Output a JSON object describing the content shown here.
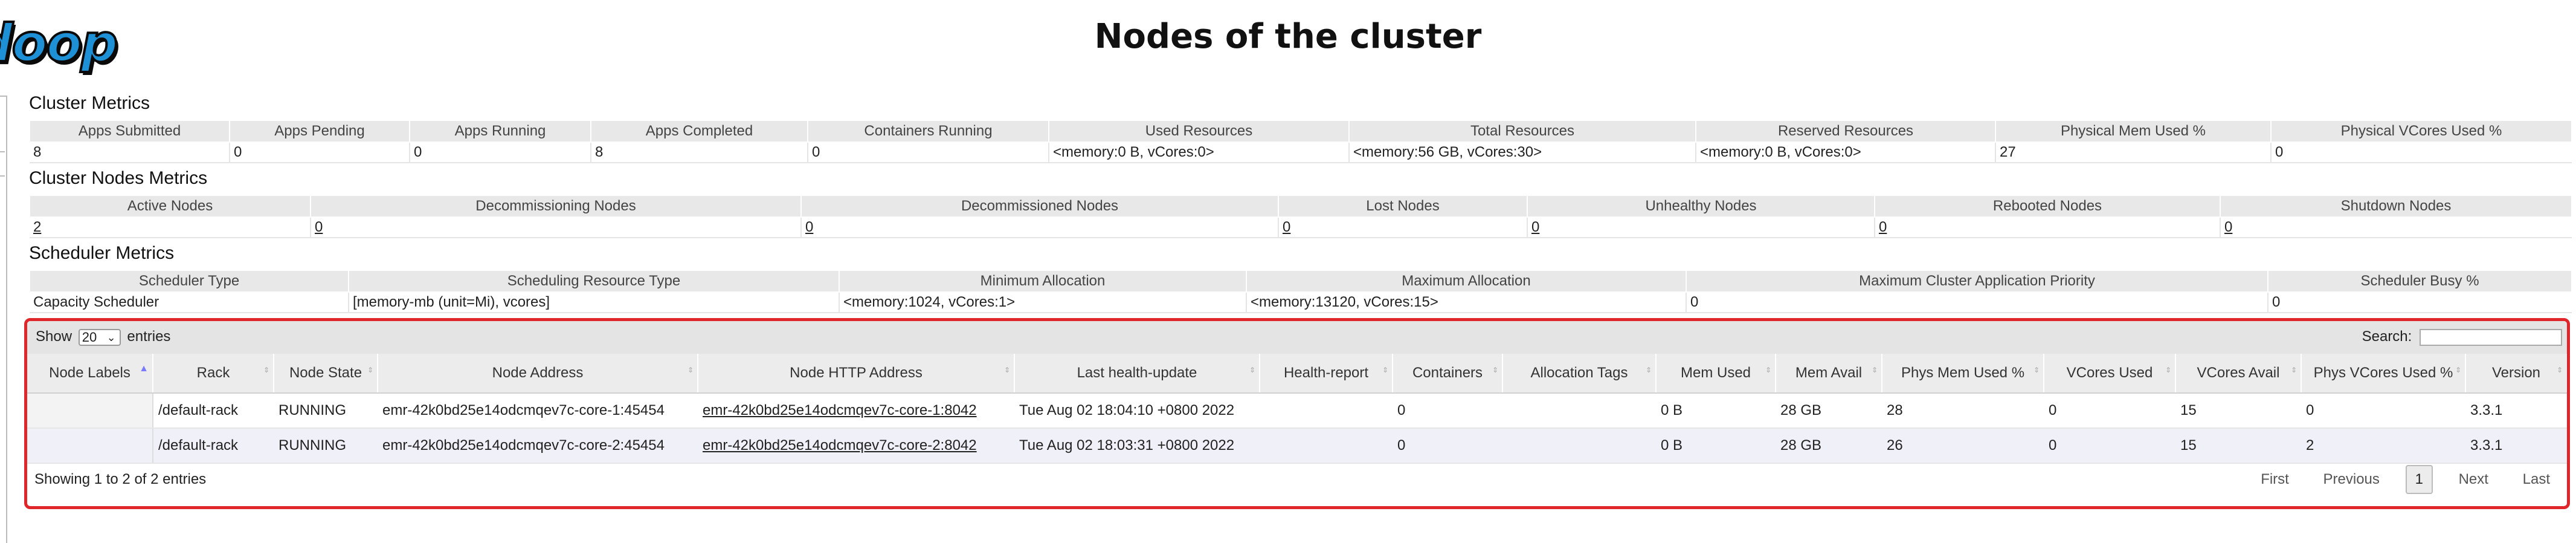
{
  "page": {
    "title": "Nodes of the cluster",
    "logo_text": "doop"
  },
  "cluster_metrics": {
    "title": "Cluster Metrics",
    "headers": [
      "Apps Submitted",
      "Apps Pending",
      "Apps Running",
      "Apps Completed",
      "Containers Running",
      "Used Resources",
      "Total Resources",
      "Reserved Resources",
      "Physical Mem Used %",
      "Physical VCores Used %"
    ],
    "values": [
      "8",
      "0",
      "0",
      "8",
      "0",
      "<memory:0 B, vCores:0>",
      "<memory:56 GB, vCores:30>",
      "<memory:0 B, vCores:0>",
      "27",
      "0"
    ]
  },
  "cluster_nodes_metrics": {
    "title": "Cluster Nodes Metrics",
    "headers": [
      "Active Nodes",
      "Decommissioning Nodes",
      "Decommissioned Nodes",
      "Lost Nodes",
      "Unhealthy Nodes",
      "Rebooted Nodes",
      "Shutdown Nodes"
    ],
    "values": [
      "2",
      "0",
      "0",
      "0",
      "0",
      "0",
      "0"
    ]
  },
  "scheduler_metrics": {
    "title": "Scheduler Metrics",
    "headers": [
      "Scheduler Type",
      "Scheduling Resource Type",
      "Minimum Allocation",
      "Maximum Allocation",
      "Maximum Cluster Application Priority",
      "Scheduler Busy %"
    ],
    "values": [
      "Capacity Scheduler",
      "[memory-mb (unit=Mi), vcores]",
      "<memory:1024, vCores:1>",
      "<memory:13120, vCores:15>",
      "0",
      "0"
    ]
  },
  "nodes_table": {
    "show_label": "Show",
    "entries_label": "entries",
    "page_length": "20",
    "search_label": "Search:",
    "search_value": "",
    "headers": [
      "Node Labels",
      "Rack",
      "Node State",
      "Node Address",
      "Node HTTP Address",
      "Last health-update",
      "Health-report",
      "Containers",
      "Allocation Tags",
      "Mem Used",
      "Mem Avail",
      "Phys Mem Used %",
      "VCores Used",
      "VCores Avail",
      "Phys VCores Used %",
      "Version"
    ],
    "rows": [
      [
        "",
        "/default-rack",
        "RUNNING",
        "emr-42k0bd25e14odcmqev7c-core-1:45454",
        "emr-42k0bd25e14odcmqev7c-core-1:8042",
        "Tue Aug 02 18:04:10 +0800 2022",
        "",
        "0",
        "",
        "0 B",
        "28 GB",
        "28",
        "0",
        "15",
        "0",
        "3.3.1"
      ],
      [
        "",
        "/default-rack",
        "RUNNING",
        "emr-42k0bd25e14odcmqev7c-core-2:45454",
        "emr-42k0bd25e14odcmqev7c-core-2:8042",
        "Tue Aug 02 18:03:31 +0800 2022",
        "",
        "0",
        "",
        "0 B",
        "28 GB",
        "26",
        "0",
        "15",
        "2",
        "3.3.1"
      ]
    ],
    "info": "Showing 1 to 2 of 2 entries",
    "pager": {
      "first": "First",
      "previous": "Previous",
      "current": "1",
      "next": "Next",
      "last": "Last"
    }
  },
  "colors": {
    "highlight_border": "#e0262b",
    "logo_blue": "#1e90d6"
  }
}
